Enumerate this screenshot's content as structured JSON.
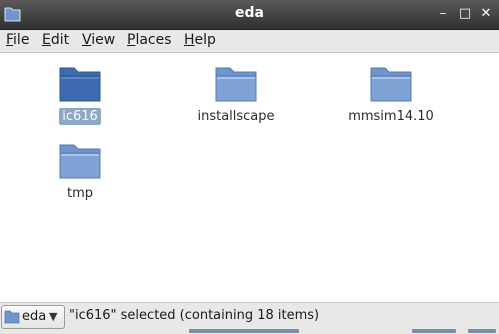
{
  "window": {
    "title": "eda",
    "controls": {
      "minimize": "–",
      "maximize": "□",
      "close": "✕"
    }
  },
  "menubar": {
    "items": [
      {
        "mnemonic": "F",
        "rest": "ile"
      },
      {
        "mnemonic": "E",
        "rest": "dit"
      },
      {
        "mnemonic": "V",
        "rest": "iew"
      },
      {
        "mnemonic": "P",
        "rest": "laces"
      },
      {
        "mnemonic": "H",
        "rest": "elp"
      }
    ]
  },
  "folders": [
    {
      "name": "ic616",
      "selected": true
    },
    {
      "name": "installscape",
      "selected": false
    },
    {
      "name": "mmsim14.10",
      "selected": false
    },
    {
      "name": "tmp",
      "selected": false
    }
  ],
  "statusbar": {
    "location": "eda",
    "status": "\"ic616\" selected (containing 18 items)"
  },
  "colors": {
    "folder": "#6f96cc",
    "folder_selected": "#3d6baf",
    "selection_bg": "#8da7c9",
    "titlebar": "#3a3a3a"
  },
  "icons": {
    "app": "folder-icon",
    "items": "folder-icon",
    "location": "folder-icon"
  }
}
